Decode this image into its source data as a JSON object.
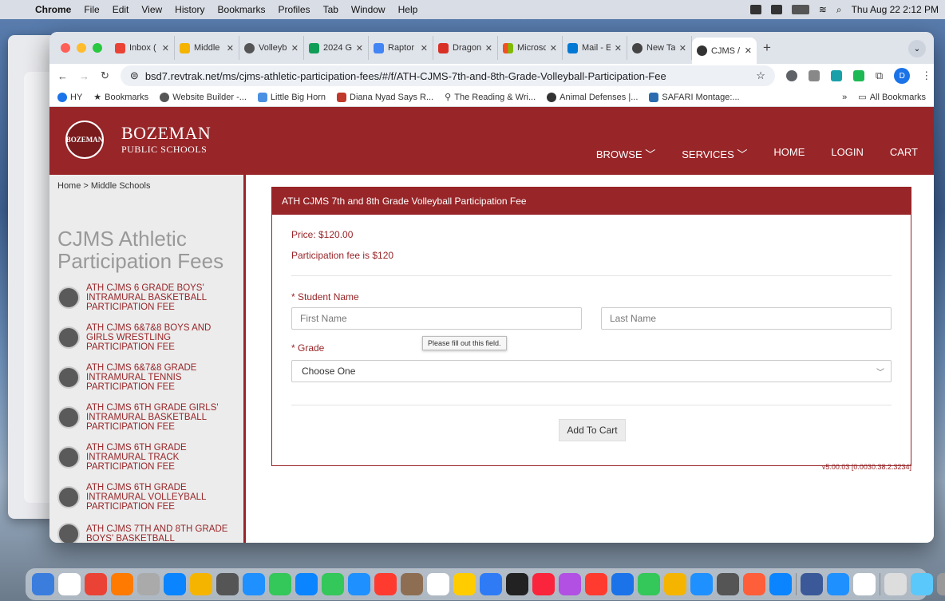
{
  "menubar": {
    "app": "Chrome",
    "items": [
      "File",
      "Edit",
      "View",
      "History",
      "Bookmarks",
      "Profiles",
      "Tab",
      "Window",
      "Help"
    ],
    "clock": "Thu Aug 22  2:12 PM"
  },
  "tabs": [
    {
      "title": "Inbox (",
      "color": "#ea4335"
    },
    {
      "title": "Middle",
      "color": "#f4b400"
    },
    {
      "title": "Volleyb",
      "color": "#555555"
    },
    {
      "title": "2024 G",
      "color": "#0f9d58"
    },
    {
      "title": "Raptor",
      "color": "#4285f4"
    },
    {
      "title": "Dragon",
      "color": "#d93025"
    },
    {
      "title": "Microsc",
      "color": "#f25022"
    },
    {
      "title": "Mail - E",
      "color": "#0078d4"
    },
    {
      "title": "New Ta",
      "color": "#444444"
    },
    {
      "title": "CJMS /",
      "color": "#333333"
    }
  ],
  "url": "bsd7.revtrak.net/ms/cjms-athletic-participation-fees/#/f/ATH-CJMS-7th-and-8th-Grade-Volleyball-Participation-Fee",
  "bookmarks": [
    "HY",
    "Bookmarks",
    "Website Builder -...",
    "Little Big Horn",
    "Diana Nyad Says R...",
    "The Reading & Wri...",
    "Animal Defenses |...",
    "SAFARI Montage:..."
  ],
  "bookmarks_right": [
    "»",
    "All Bookmarks"
  ],
  "avatar_letter": "D",
  "site": {
    "brand1": "BOZEMAN",
    "brand2": "PUBLIC SCHOOLS",
    "logo_text": "BOZEMAN",
    "nav": [
      "BROWSE ﹀",
      "SERVICES ﹀",
      "HOME",
      "LOGIN",
      "CART"
    ]
  },
  "sidebar": {
    "breadcrumb": "Home > Middle Schools",
    "title": "CJMS Athletic Participation Fees",
    "items": [
      "ATH CJMS 6 GRADE BOYS' INTRAMURAL BASKETBALL PARTICIPATION FEE",
      "ATH CJMS 6&7&8 BOYS AND GIRLS WRESTLING PARTICIPATION FEE",
      "ATH CJMS 6&7&8 GRADE INTRAMURAL TENNIS PARTICIPATION FEE",
      "ATH CJMS 6TH GRADE GIRLS' INTRAMURAL BASKETBALL PARTICIPATION FEE",
      "ATH CJMS 6TH GRADE INTRAMURAL TRACK PARTICIPATION FEE",
      "ATH CJMS 6TH GRADE INTRAMURAL VOLLEYBALL PARTICIPATION FEE",
      "ATH CJMS 7TH AND 8TH GRADE BOYS' BASKETBALL"
    ]
  },
  "product": {
    "header": "ATH CJMS 7th and 8th Grade Volleyball Participation Fee",
    "price": "Price: $120.00",
    "fee_note": "Participation fee is $120",
    "student_label": "* Student Name",
    "first_placeholder": "First Name",
    "last_placeholder": "Last Name",
    "tooltip": "Please fill out this field.",
    "grade_label": "* Grade",
    "grade_value": "Choose One",
    "add_button": "Add To Cart",
    "version": "v5.00.03 [0.0030:38.2.3234]"
  },
  "dock_colors": [
    "#3b7ddd",
    "#ffffff",
    "#ea4335",
    "#ff7a00",
    "#aaaaaa",
    "#0a84ff",
    "#f4b400",
    "#555555",
    "#1e90ff",
    "#34c759",
    "#0a84ff",
    "#34c759",
    "#1e90ff",
    "#ff3b30",
    "#8e6e53",
    "#ffffff",
    "#ffcc00",
    "#2f7bf6",
    "#222222",
    "#fa243c",
    "#b150e2",
    "#ff3b30",
    "#1a73e8",
    "#34c759",
    "#f4b400",
    "#1e90ff",
    "#555555",
    "#ff5e3a",
    "#0a84ff",
    "#3b5998",
    "#1e90ff",
    "#ffffff",
    "#dddddd",
    "#5ac8fa",
    "#999999",
    "#cccccc"
  ]
}
